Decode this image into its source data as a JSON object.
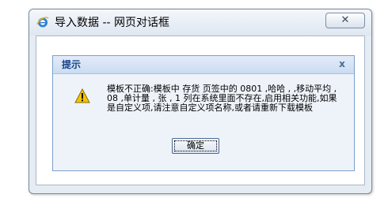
{
  "window": {
    "title": "导入数据 -- 网页对话框",
    "close_glyph": "✕",
    "icon": "ie-icon"
  },
  "message_box": {
    "title": "提示",
    "close_glyph": "x",
    "icon": "warning-icon",
    "message": "模板不正确:模板中 存货 页签中的 0801 ,哈哈 , ,移动平均 , 08 ,单计量 , 张 , 1 列在系统里面不存在,启用相关功能,如果是自定义项,请注意自定义项名称,或者请重新下载模板",
    "ok_label": "确定"
  },
  "colors": {
    "header_text": "#15428b",
    "warning_yellow": "#f5c400"
  }
}
